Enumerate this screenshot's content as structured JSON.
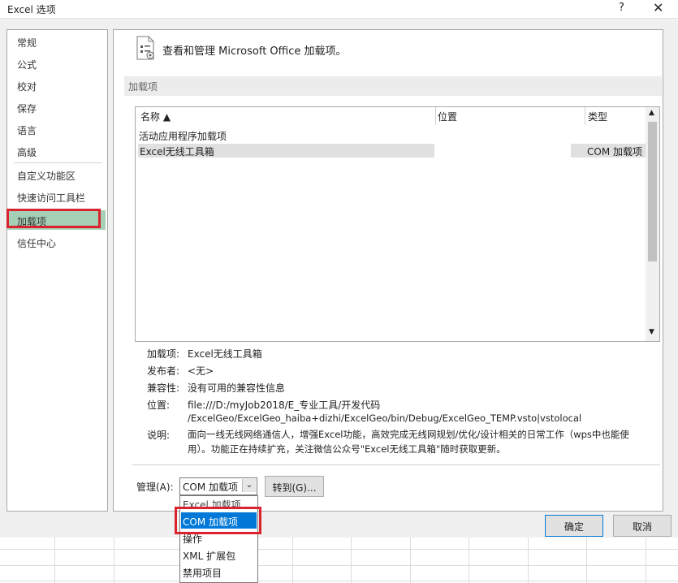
{
  "window": {
    "title": "Excel 选项",
    "help": "?",
    "close": "✕"
  },
  "nav": {
    "items": [
      "常规",
      "公式",
      "校对",
      "保存",
      "语言",
      "高级",
      "自定义功能区",
      "快速访问工具栏",
      "加载项",
      "信任中心"
    ],
    "selected": "加载项"
  },
  "header": {
    "icon": "addins-icon",
    "text": "查看和管理 Microsoft Office 加载项。"
  },
  "section": {
    "title": "加载项"
  },
  "list": {
    "columns": [
      "名称 ▲",
      "位置",
      "类型"
    ],
    "group": "活动应用程序加载项",
    "rows": [
      {
        "name": "Excel无线工具箱",
        "location": "",
        "type": "COM 加载项"
      }
    ]
  },
  "details": {
    "addin_label": "加载项:",
    "addin_value": "Excel无线工具箱",
    "publisher_label": "发布者:",
    "publisher_value": "<无>",
    "compat_label": "兼容性:",
    "compat_value": "没有可用的兼容性信息",
    "location_label": "位置:",
    "location_line1": "file:///D:/myJob2018/E_专业工具/开发代码",
    "location_line2": "/ExcelGeo/ExcelGeo_haiba+dizhi/ExcelGeo/bin/Debug/ExcelGeo_TEMP.vsto|vstolocal",
    "desc_label": "说明:",
    "desc_line1": "面向一线无线网络通信人，增强Excel功能，高效完成无线网规划/优化/设计相关的日常工作（wps中也能使",
    "desc_line2": "用）。功能正在持续扩充，关注微信公众号\"Excel无线工具箱\"随时获取更新。"
  },
  "manage": {
    "label": "管理(A):",
    "selected": "COM 加载项",
    "goto": "转到(G)...",
    "options": [
      "Excel 加载项",
      "COM 加载项",
      "操作",
      "XML 扩展包",
      "禁用项目"
    ]
  },
  "buttons": {
    "ok": "确定",
    "cancel": "取消"
  },
  "colors": {
    "selection": "#0078d7",
    "nav_selected": "#a6d0b5",
    "highlight_box": "#d9232e"
  }
}
